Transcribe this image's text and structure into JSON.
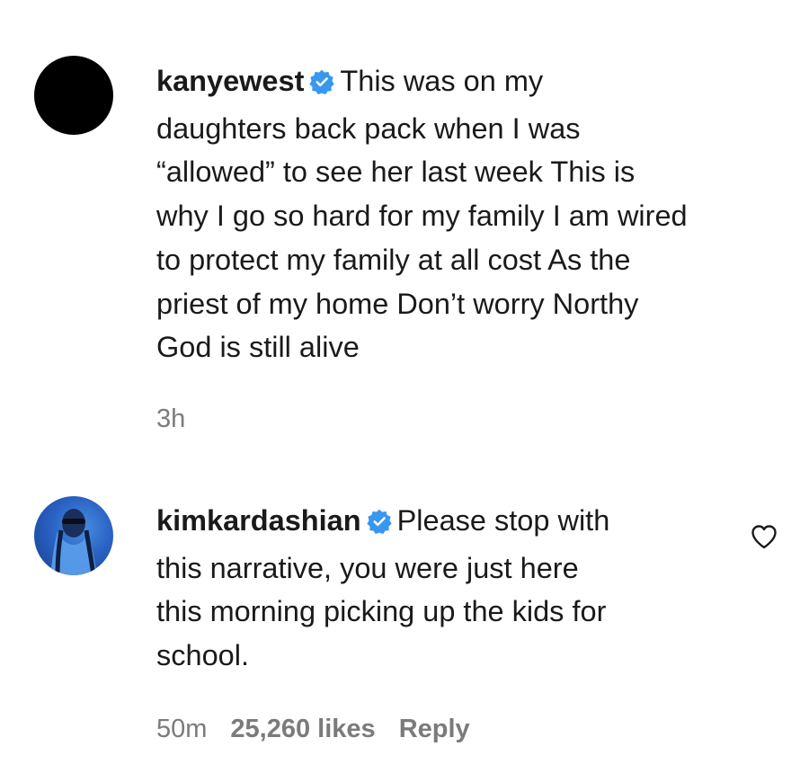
{
  "comments": [
    {
      "username": "kanyewest",
      "verified": true,
      "avatar": "black-circle-avatar",
      "lines": [
        "This was on my",
        "daughters back pack when I was",
        "“allowed” to see her last week This is",
        "why I go so hard for my family I am wired",
        "to protect my family at all cost As the",
        "priest of my home Don’t worry Northy",
        "God is still alive"
      ],
      "time": "3h"
    },
    {
      "username": "kimkardashian",
      "verified": true,
      "avatar": "profile-photo-avatar",
      "lines": [
        "Please stop with",
        "this narrative, you were just here",
        "this morning picking up the kids for",
        "school."
      ],
      "time": "50m",
      "likes": "25,260 likes",
      "reply_label": "Reply",
      "like_icon": "heart-outline-icon"
    }
  ],
  "colors": {
    "verified_badge": "#3897f0",
    "meta_text": "#7b7b7b",
    "body_text": "#1a1a1a"
  }
}
